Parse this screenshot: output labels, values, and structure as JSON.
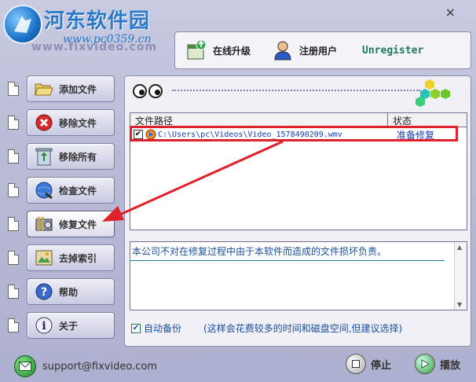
{
  "header": {
    "watermark_title": "河东软件园",
    "watermark_url": "www.pc0359.cn",
    "ghost_site": "www.fixvideo.com",
    "close_label": "×"
  },
  "toolbar": {
    "upgrade_label": "在线升级",
    "register_label": "注册用户",
    "status_label": "Unregister"
  },
  "sidebar": {
    "items": [
      {
        "label": "添加文件",
        "icon": "folder-open-icon"
      },
      {
        "label": "移除文件",
        "icon": "remove-x-icon"
      },
      {
        "label": "移除所有",
        "icon": "recycle-bin-icon"
      },
      {
        "label": "检查文件",
        "icon": "globe-check-icon"
      },
      {
        "label": "修复文件",
        "icon": "repair-tools-icon"
      },
      {
        "label": "去掉索引",
        "icon": "index-image-icon"
      },
      {
        "label": "帮助",
        "icon": "help-icon"
      },
      {
        "label": "关于",
        "icon": "info-icon"
      }
    ]
  },
  "file_table": {
    "columns": [
      "文件路径",
      "状态"
    ],
    "rows": [
      {
        "checked": true,
        "path": "C:\\Users\\pc\\Videos\\Video_1578490209.wmv",
        "status": "准备修复"
      }
    ]
  },
  "log": {
    "message": "本公司不对在修复过程中由于本软件而造成的文件损坏负责。"
  },
  "options": {
    "auto_backup_label": "自动备份",
    "auto_backup_checked": true,
    "auto_backup_note": "(这样会花费较多的时间和磁盘空间,但建议选择)"
  },
  "footer": {
    "support_email": "support@fixvideo.com",
    "stop_label": "停止",
    "play_label": "播放"
  },
  "colors": {
    "annotation": "#e0202a",
    "accent_text": "#1a3bb0",
    "window_bg": "#b9bbd6"
  }
}
